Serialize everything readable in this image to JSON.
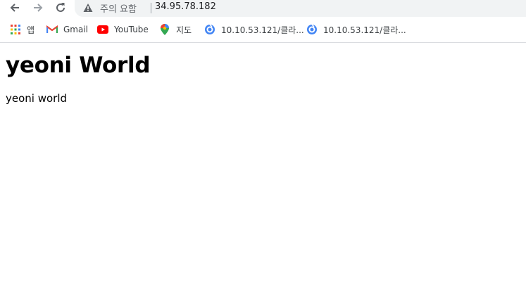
{
  "browser": {
    "security_label": "주의 요함",
    "url": "34.95.78.182",
    "nav_icons": [
      "back-arrow-icon",
      "forward-arrow-icon",
      "reload-icon"
    ]
  },
  "bookmarks": [
    {
      "label": "앱",
      "icon": "apps-grid-icon"
    },
    {
      "label": "Gmail",
      "icon": "gmail-icon"
    },
    {
      "label": "YouTube",
      "icon": "youtube-icon"
    },
    {
      "label": "지도",
      "icon": "maps-pin-icon"
    },
    {
      "label": "10.10.53.121/클라...",
      "icon": "site-globe-icon"
    },
    {
      "label": "10.10.53.121/클라...",
      "icon": "site-globe-icon"
    }
  ],
  "page": {
    "heading": "yeoni World",
    "body_text": "yeoni world"
  },
  "colors": {
    "omnibox_bg": "#f1f3f4",
    "youtube_red": "#ff0000",
    "gmail_red": "#ea4335",
    "link_blue": "#4285f4"
  }
}
